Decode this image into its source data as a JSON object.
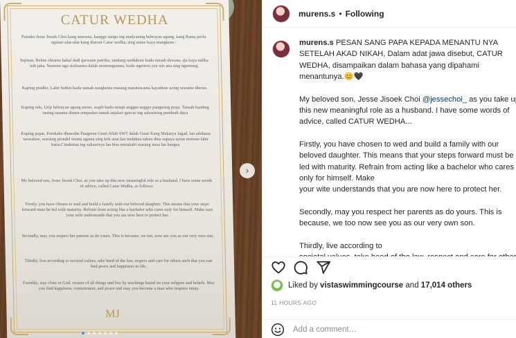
{
  "media": {
    "card_title": "CATUR WEDHA",
    "javanese_paragraphs": [
      "Putrako Jesse Jisoek Choi kang sutresna, kanggo sangu ing madyaning bebrayan agung, kang Rama perlu ngaturi ular-ular kang diarani Catur wedha, sing unine kaya mangkene :",
      "Sepisan, Rehne sliramu bakal dadi garwane putriku, tandang tandukmu kudu tansah dewasa, aja kaya nalika isih jaka. Semono uga sisihanmu dalah momonganmu, kudu ngerteni yen wis ana sing ngemong.",
      "Kaping pindho, Lahir bathin kudu tansah sungkema marang maratuwamu kayadene wong tuwamu dhewe.",
      "Kaping telu, Urip bebrayan agung mono, wajib kudu netepi angger-angger paugering praja. Tansah hambeg raning sasama dimen simpudan tamah anjalari gancar ing saluwiring pambudi daya",
      "Kaping papat, Estokake dhawuhe Pangeran Gusti Allah SWT dalah Gusti Kang Makarya Jagad, lan adohana wewalere, waraing piondel utama agama sing kok anut lan tindakna saben dina supaya ayem tentrem lahir batin.Cinaketna ing sukawirya lan bisa murakabi marang nusa lan bangsa."
    ],
    "english_paragraphs": [
      "My beloved son, Jesse Jisoek Choi, as you take up this new meaningful role as a husband, I have some words of advice, called Catur Wedha, as follows:",
      "Firstly, you have chosen to wed and build a family with our beloved daughter. This means that your steps forward must be led with maturity. Refrain from acting like a bachelor who cares only for himself. Make sure your wife understands that you are now here to protect her.",
      "Secondly, may you respect her parents as do yours. This is because, we too, now see you as our very own son.",
      "Thirdly, live according to societal values, take heed of the law, respect and care for others such that you can find peace and happiness in life.",
      "Fourthly, stay close to God, creator of all things and live by teachings based on your religion and beliefs. May you find happiness, contentment, and peace and may you become a man who inspires many."
    ],
    "monogram": "MJ",
    "next_arrow": "›"
  },
  "header": {
    "username": "murens.s",
    "separator": "•",
    "follow_label": "Following"
  },
  "caption": {
    "username": "murens.s",
    "intro": "PESAN SANG PAPA KEPADA MENANTU NYA SETELAH AKAD NIKAH, Dalam adat jawa disebut, CATUR WEDHA, disampaikan dalam bahasa yang dipahami menantunya.😊🖤",
    "p1_before": "My beloved son, Jesse Jisoek Choi ",
    "p1_mention": "@jessechoi_",
    "p1_after": " as you take up this new meaningful role as a husband. I have some words of advice, called CATUR WEDHA...",
    "p2_a": "Firstly, you have chosen to wed and build a family with our beloved daughter. This means that your steps forward must be led with maturity. Refrain from acting like a bachelor who cares only for himself. Make",
    "p2_b": "your wite understands that you are now here to protect her.",
    "p3": "Secondly, may you respect her parents as do yours. This is because, we too now see you as our very own son.",
    "p4_a": "Thirdly, live according to",
    "p4_b": "societal values, take heed of the law, respect and care for others"
  },
  "likes": {
    "prefix": "Liked by ",
    "user": "vistaswimmingcourse",
    "middle": " and ",
    "count": "17,014 others"
  },
  "timestamp": "11 HOURS AGO",
  "comment": {
    "placeholder": "Add a comment…"
  },
  "icons": {
    "heart": "heart-icon",
    "comment": "comment-icon",
    "share": "share-icon",
    "emoji": "emoji-icon",
    "next": "chevron-right-icon"
  },
  "colors": {
    "link": "#00376b",
    "gold": "#b8975a",
    "muted": "#8e8e8e"
  }
}
